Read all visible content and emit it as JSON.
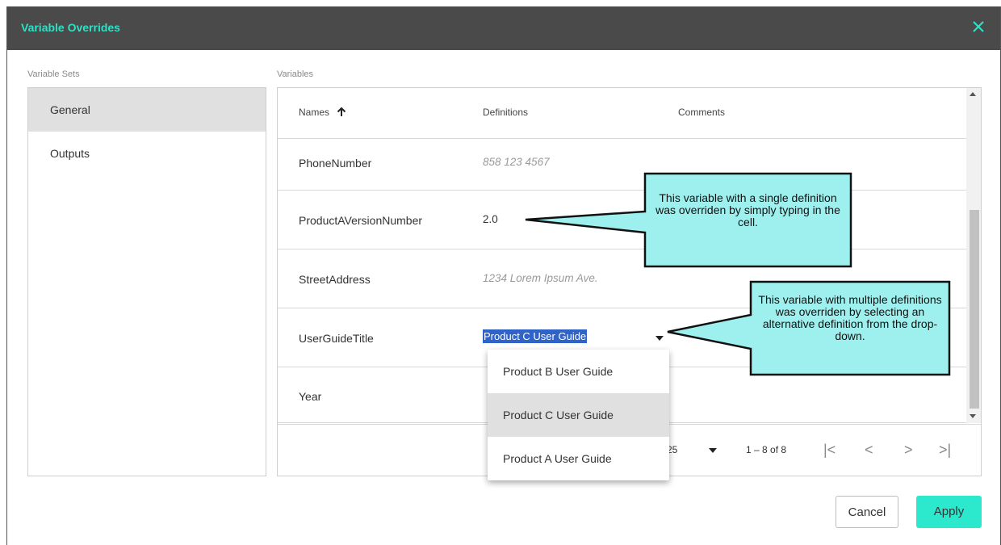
{
  "dialog": {
    "title": "Variable Overrides",
    "close_icon": "close-icon",
    "accent_color": "#2be2c6",
    "titlebar_color": "#4a4a4a"
  },
  "sets": {
    "label": "Variable Sets",
    "items": [
      {
        "label": "General",
        "selected": true
      },
      {
        "label": "Outputs",
        "selected": false
      }
    ]
  },
  "variables": {
    "label": "Variables",
    "columns": {
      "names": "Names",
      "sort_icon": "arrow-up-icon",
      "definitions": "Definitions",
      "comments": "Comments"
    },
    "rows": [
      {
        "name": "PhoneNumber",
        "definition": "858 123 4567",
        "placeholder": true
      },
      {
        "name": "ProductAVersionNumber",
        "definition": "2.0",
        "placeholder": false
      },
      {
        "name": "StreetAddress",
        "definition": "1234 Lorem Ipsum Ave.",
        "placeholder": true
      },
      {
        "name": "UserGuideTitle",
        "definition": "Product C User Guide",
        "selected": true,
        "dropdown": true
      },
      {
        "name": "Year",
        "definition": ""
      }
    ]
  },
  "dropdown": {
    "options": [
      "Product B User Guide",
      "Product C User Guide",
      "Product A User Guide"
    ],
    "highlighted": "Product C User Guide"
  },
  "paginator": {
    "page_size": "25",
    "range": "1 – 8 of 8",
    "first": "|<",
    "prev": "<",
    "next": ">",
    "last": ">|"
  },
  "callouts": [
    {
      "text": "This variable with a single definition was overriden by simply typing in the cell.",
      "color": "#9ef0ee"
    },
    {
      "text": "This variable with multiple definitions was overriden by selecting an alternative definition from the drop-down.",
      "color": "#9ef0ee"
    }
  ],
  "footer": {
    "cancel": "Cancel",
    "apply": "Apply"
  }
}
